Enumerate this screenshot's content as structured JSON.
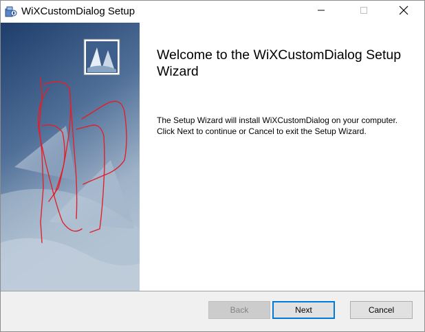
{
  "window": {
    "title": "WiXCustomDialog Setup",
    "icon": "installer-package-icon"
  },
  "title_buttons": {
    "minimize_icon": "minimize-icon",
    "maximize_icon": "maximize-icon",
    "close_icon": "close-icon"
  },
  "main": {
    "heading": "Welcome to the WiXCustomDialog Setup Wizard",
    "description": "The Setup Wizard will install WiXCustomDialog on your computer. Click Next to continue or Cancel to exit the Setup Wizard."
  },
  "buttons": {
    "back": "Back",
    "next": "Next",
    "cancel": "Cancel"
  },
  "colors": {
    "banner_dark": "#1f3a63",
    "banner_light": "#c9d3de",
    "annotation_red": "#e0202a",
    "focus_border": "#0078d7"
  }
}
